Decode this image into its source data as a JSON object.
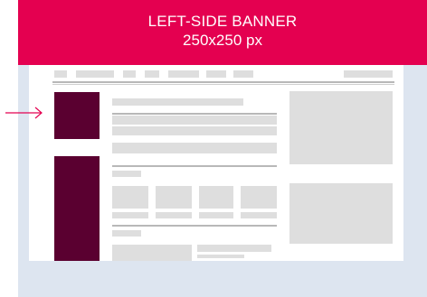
{
  "banner": {
    "title": "LEFT-SIDE BANNER",
    "size": "250x250 px"
  },
  "colors": {
    "banner_bg": "#e40050",
    "ad_placeholder": "#5a0030",
    "frame_bg": "#dde5f0",
    "arrow": "#e40050",
    "placeholder_block": "#dedede"
  }
}
